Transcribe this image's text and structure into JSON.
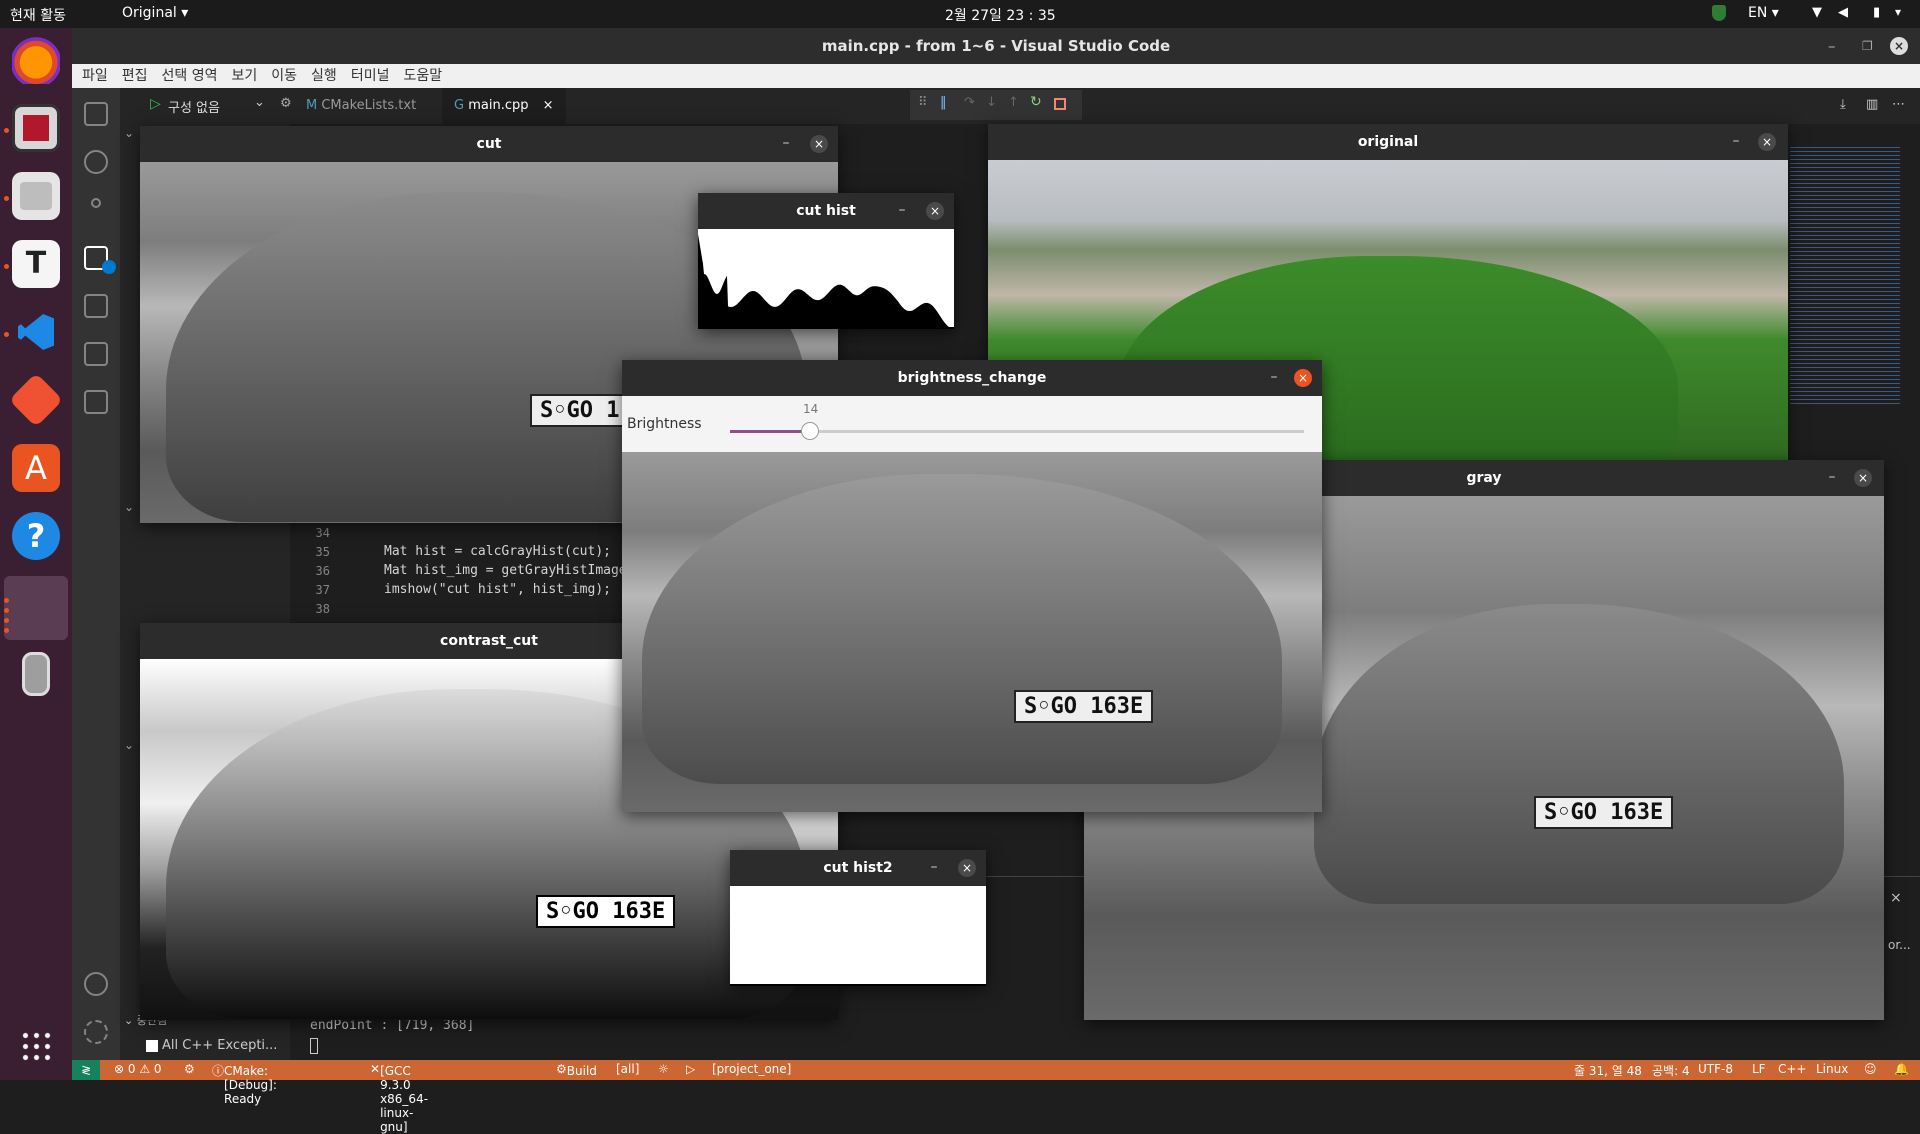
{
  "topbar": {
    "activities": "현재 활동",
    "app_menu": "Original ▾",
    "clock": "2월 27일  23 : 35",
    "lang": "EN ▾"
  },
  "vscode": {
    "title": "main.cpp - from 1~6 - Visual Studio Code",
    "menu": [
      "파일",
      "편집",
      "선택 영역",
      "보기",
      "이동",
      "실행",
      "터미널",
      "도움말"
    ],
    "debug_config": "구성 없음",
    "tabs": [
      {
        "label": "CMakeLists.txt",
        "prefix": "M"
      },
      {
        "label": "main.cpp",
        "prefix": "G"
      }
    ],
    "code_lines": [
      {
        "num": "34",
        "text": ""
      },
      {
        "num": "35",
        "text": "Mat hist = calcGrayHist(cut);"
      },
      {
        "num": "36",
        "text": "Mat hist_img = getGrayHistImage(hi"
      },
      {
        "num": "37",
        "text": "imshow(\"cut hist\", hist_img);"
      },
      {
        "num": "38",
        "text": ""
      }
    ],
    "terminal_output": "endPoint : [719, 368]",
    "breakpoints_section": "중단점",
    "breakpoint_item": "All C++ Excepti...",
    "status": {
      "errors": "⊗ 0 ⚠ 0",
      "cmake": "CMake: [Debug]: Ready",
      "kit": "[GCC 9.3.0 x86_64-linux-gnu]",
      "build": "Build",
      "target": "[all]",
      "project": "[project_one]",
      "position": "줄 31, 열 48",
      "spaces": "공백: 4",
      "encoding": "UTF-8",
      "eol": "LF",
      "language": "C++",
      "platform": "Linux"
    },
    "panel_clipped_text": "or..."
  },
  "windows": {
    "cut": {
      "title": "cut",
      "plate": "S◦GO 1("
    },
    "cut_hist": {
      "title": "cut hist"
    },
    "original": {
      "title": "original"
    },
    "brightness": {
      "title": "brightness_change",
      "trackbar_label": "Brightness",
      "trackbar_value": "14",
      "trackbar_max": 100,
      "plate": "S◦GO 163E"
    },
    "gray": {
      "title": "gray",
      "plate": "S◦GO 163E"
    },
    "contrast_cut": {
      "title": "contrast_cut",
      "plate": "S◦GO 163E"
    },
    "cut_hist2": {
      "title": "cut hist2"
    }
  },
  "icons": {
    "minimize": "–",
    "close": "×"
  }
}
